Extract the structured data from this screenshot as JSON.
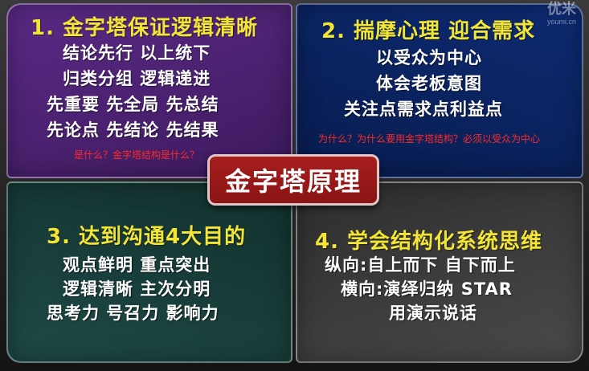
{
  "colors": {
    "q1_bg": "#5b2a86",
    "q2_bg": "#0d2b73",
    "q3_bg": "#1e4a46",
    "q4_bg": "#4a4a4a",
    "center_bg": "#8a1414",
    "title_color": "#f2e535",
    "annotation_color": "#ff2a2a"
  },
  "quadrants": [
    {
      "title": "1. 金字塔保证逻辑清晰",
      "lines": [
        "结论先行  以上统下",
        "归类分组  逻辑递进",
        "先重要  先全局  先总结",
        "先论点  先结论  先结果"
      ]
    },
    {
      "title": "2. 揣摩心理  迎合需求",
      "lines": [
        "以受众为中心",
        "体会老板意图",
        "关注点需求点利益点"
      ]
    },
    {
      "title": "3. 达到沟通4大目的",
      "lines": [
        "观点鲜明  重点突出",
        "逻辑清晰  主次分明",
        "思考力  号召力  影响力"
      ]
    },
    {
      "title": "4. 学会结构化系统思维",
      "lines": [
        "纵向:自上而下  自下而上",
        "横向:演绎归纳  STAR",
        "用演示说话"
      ]
    }
  ],
  "center_label": "金字塔原理",
  "annotations": {
    "right": "为什么？为什么要用金字塔结构？必须以受众为中心",
    "left": "是什么？金字塔结构是什么？"
  },
  "watermark": {
    "brand": "优米",
    "site": "youmi.cn"
  }
}
